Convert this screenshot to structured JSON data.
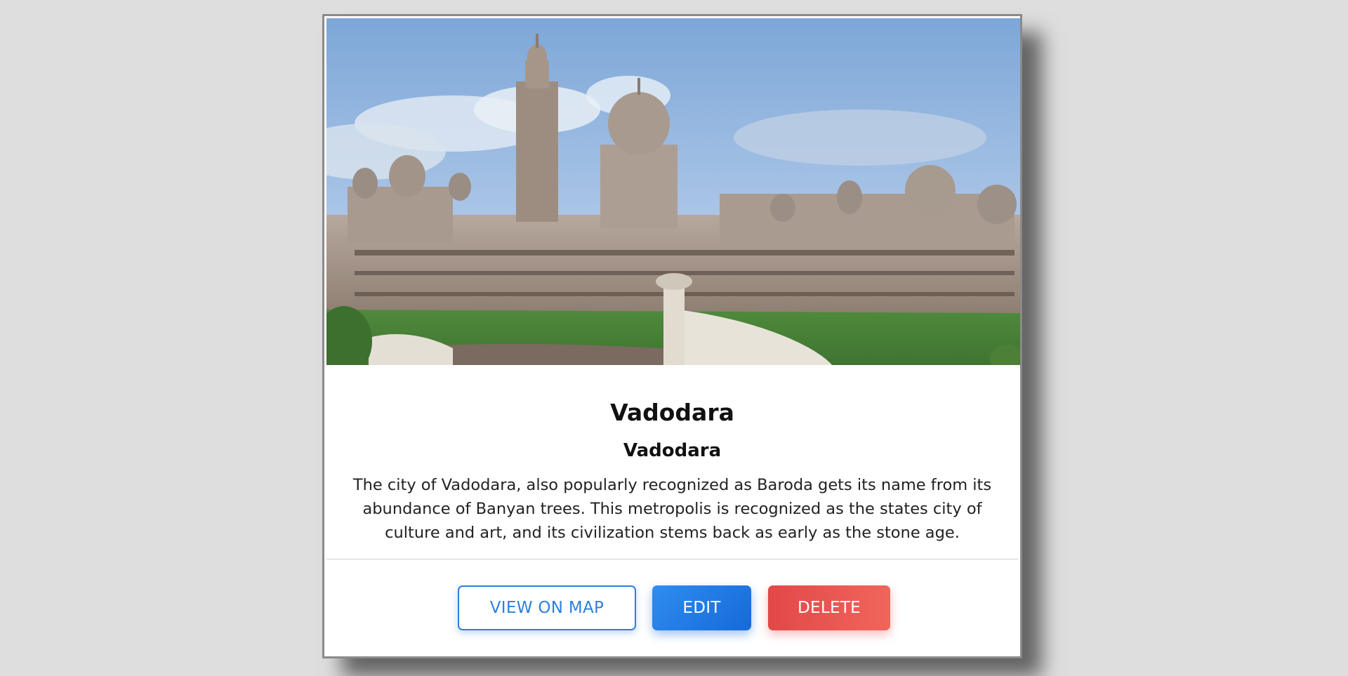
{
  "place": {
    "title": "Vadodara",
    "subtitle": "Vadodara",
    "description": "The city of Vadodara, also popularly recognized as Baroda gets its name from its abundance of Banyan trees. This metropolis is recognized as the states city of culture and art, and its civilization stems back as early as the stone age."
  },
  "actions": {
    "view_on_map": "VIEW ON MAP",
    "edit": "EDIT",
    "delete": "DELETE"
  },
  "colors": {
    "primary": "#2d7fe0",
    "danger": "#e24848",
    "background": "#dedede"
  }
}
